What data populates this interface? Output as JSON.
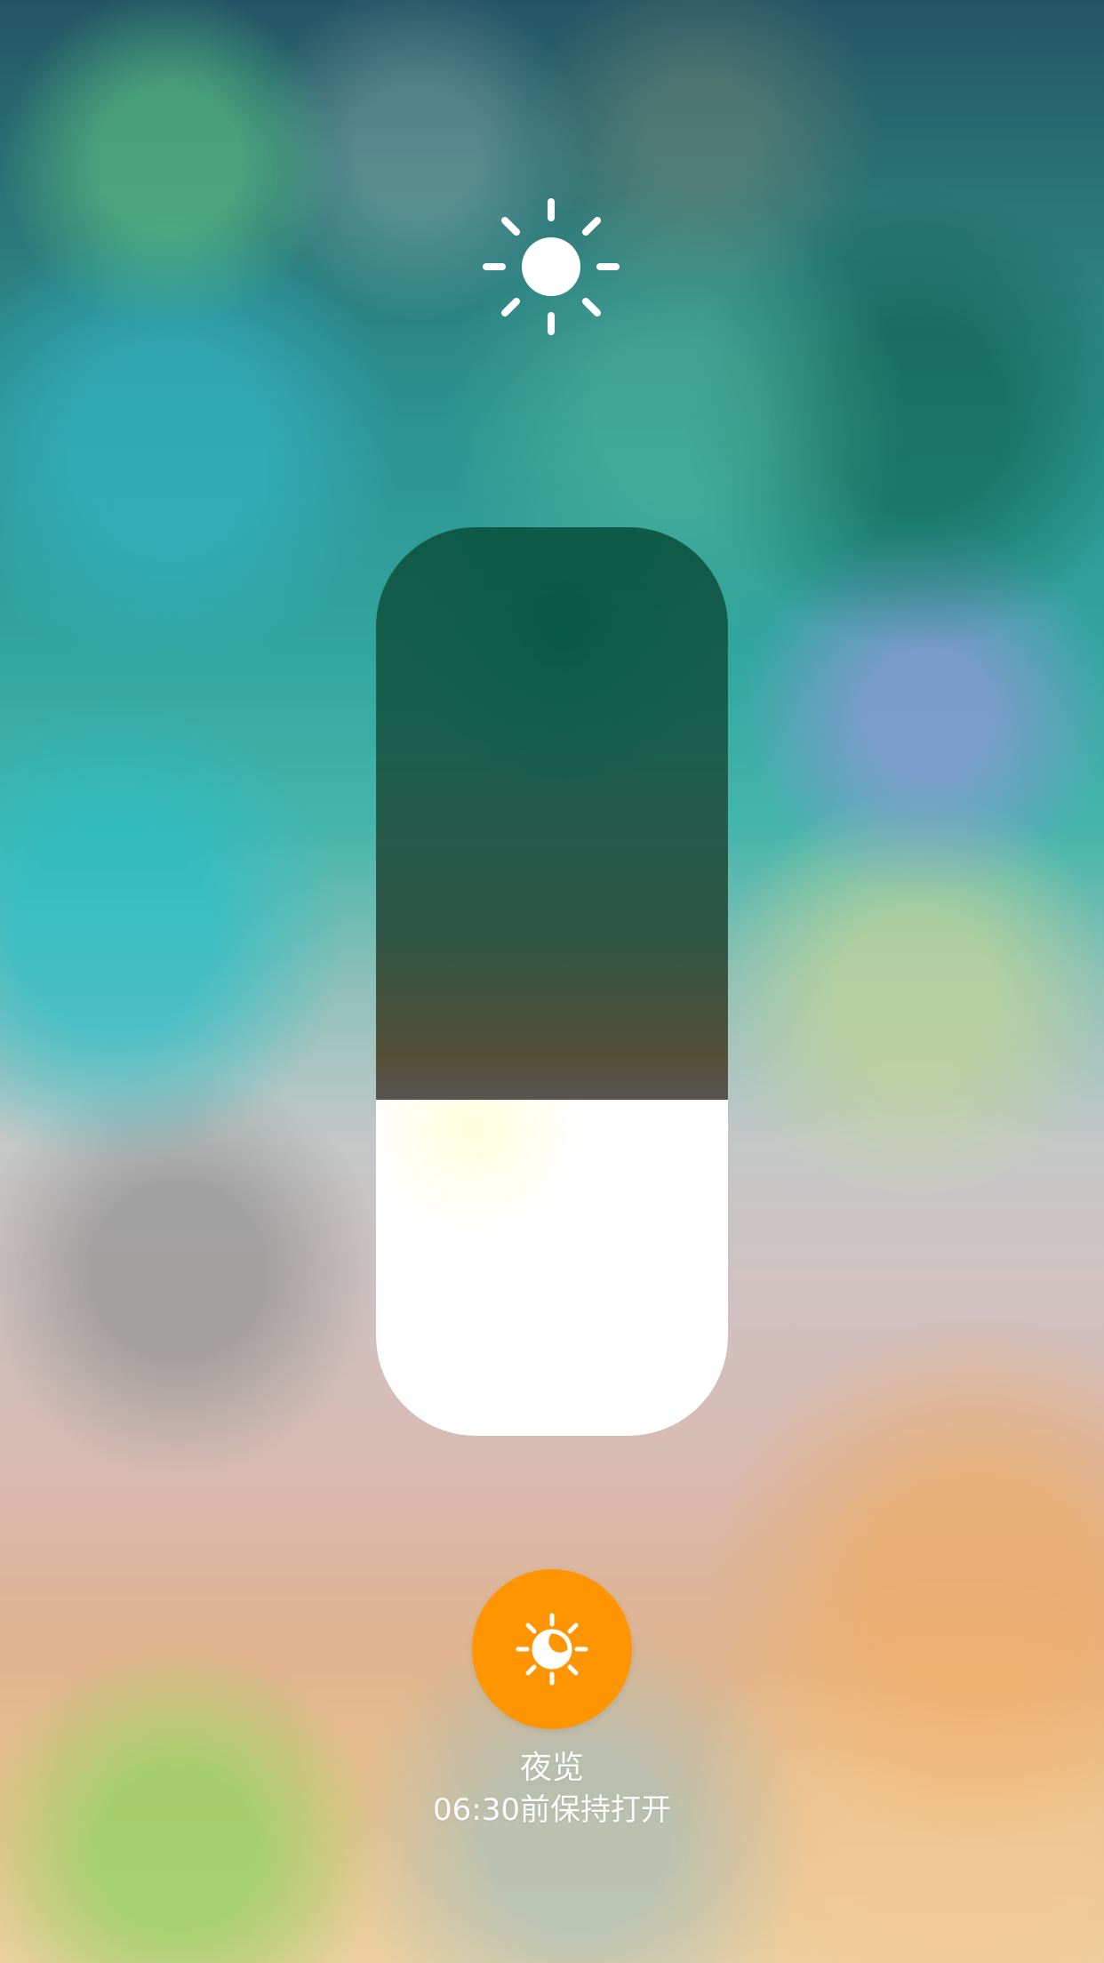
{
  "brightness": {
    "top_icon": "sun-icon",
    "level": 0.37,
    "fill_color": "#FFFFFF"
  },
  "night_shift": {
    "icon": "night-shift-icon",
    "accent": "#FF9500",
    "title": "夜览",
    "status": "06:30前保持打开"
  }
}
